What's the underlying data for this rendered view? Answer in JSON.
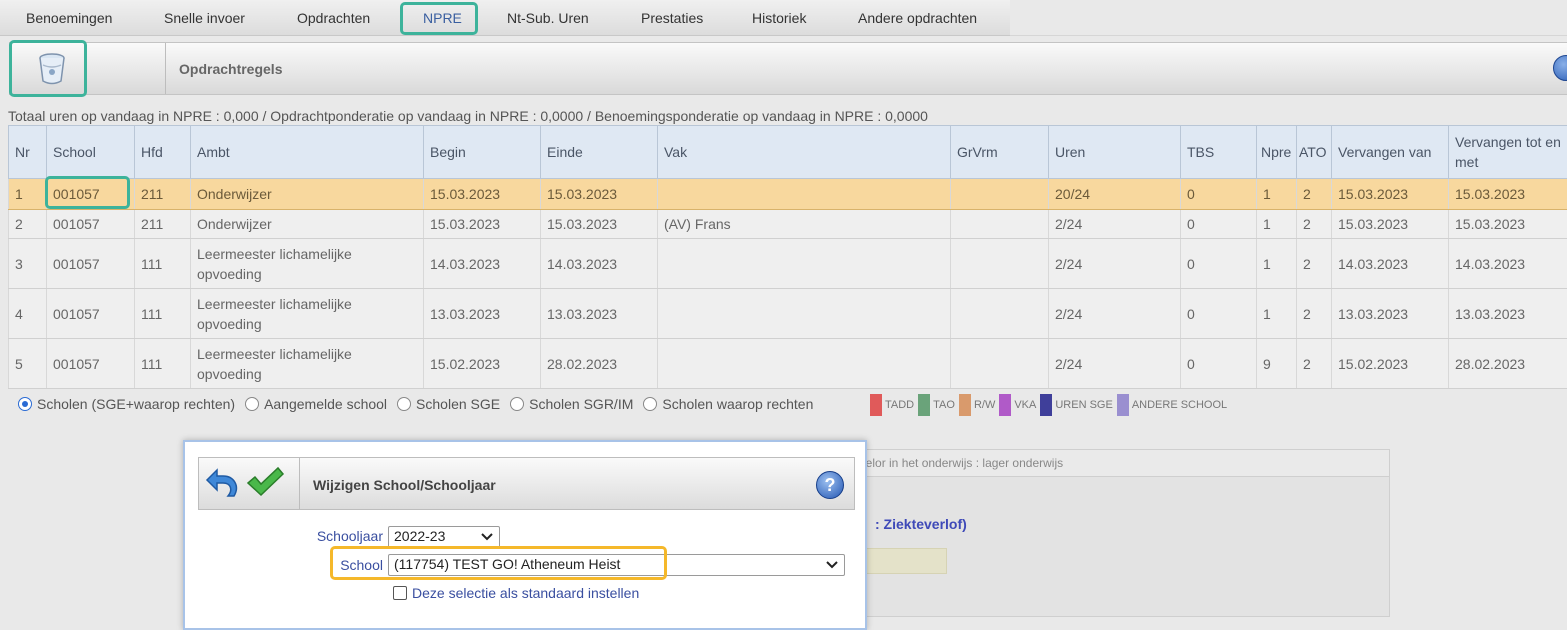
{
  "tabs": [
    {
      "label": "Benoemingen",
      "active": false
    },
    {
      "label": "Snelle invoer",
      "active": false
    },
    {
      "label": "Opdrachten",
      "active": false
    },
    {
      "label": "NPRE",
      "active": true
    },
    {
      "label": "Nt-Sub. Uren",
      "active": false
    },
    {
      "label": "Prestaties",
      "active": false
    },
    {
      "label": "Historiek",
      "active": false
    },
    {
      "label": "Andere opdrachten",
      "active": false
    }
  ],
  "toolbar": {
    "title": "Opdrachtregels"
  },
  "totals": "Totaal uren op vandaag in NPRE : 0,000 / Opdrachtponderatie op vandaag in NPRE : 0,0000 / Benoemingsponderatie op vandaag in NPRE : 0,0000",
  "table": {
    "headers": [
      "Nr",
      "School",
      "Hfd",
      "Ambt",
      "Begin",
      "Einde",
      "Vak",
      "GrVrm",
      "Uren",
      "TBS",
      "Npre",
      "ATO",
      "Vervangen van",
      "Vervangen tot en met"
    ],
    "rows": [
      [
        "1",
        "001057",
        "211",
        "Onderwijzer",
        "15.03.2023",
        "15.03.2023",
        "",
        "",
        "20/24",
        "0",
        "1",
        "2",
        "15.03.2023",
        "15.03.2023"
      ],
      [
        "2",
        "001057",
        "211",
        "Onderwijzer",
        "15.03.2023",
        "15.03.2023",
        "(AV) Frans",
        "",
        "2/24",
        "0",
        "1",
        "2",
        "15.03.2023",
        "15.03.2023"
      ],
      [
        "3",
        "001057",
        "111",
        "Leermeester lichamelijke opvoeding",
        "14.03.2023",
        "14.03.2023",
        "",
        "",
        "2/24",
        "0",
        "1",
        "2",
        "14.03.2023",
        "14.03.2023"
      ],
      [
        "4",
        "001057",
        "111",
        "Leermeester lichamelijke opvoeding",
        "13.03.2023",
        "13.03.2023",
        "",
        "",
        "2/24",
        "0",
        "1",
        "2",
        "13.03.2023",
        "13.03.2023"
      ],
      [
        "5",
        "001057",
        "111",
        "Leermeester lichamelijke opvoeding",
        "15.02.2023",
        "28.02.2023",
        "",
        "",
        "2/24",
        "0",
        "9",
        "2",
        "15.02.2023",
        "28.02.2023"
      ]
    ]
  },
  "radios": [
    {
      "label": "Scholen (SGE+waarop rechten)",
      "checked": true
    },
    {
      "label": "Aangemelde school",
      "checked": false
    },
    {
      "label": "Scholen SGE",
      "checked": false
    },
    {
      "label": "Scholen SGR/IM",
      "checked": false
    },
    {
      "label": "Scholen waarop rechten",
      "checked": false
    }
  ],
  "legend": [
    {
      "label": "TADD",
      "color": "#e05a5a"
    },
    {
      "label": "TAO",
      "color": "#6aa37a"
    },
    {
      "label": "R/W",
      "color": "#d99a6c"
    },
    {
      "label": "VKA",
      "color": "#b05ac8"
    },
    {
      "label": "UREN SGE",
      "color": "#3f3f9a"
    },
    {
      "label": "ANDERE SCHOOL",
      "color": "#9a8fd0"
    }
  ],
  "background_panel": {
    "header": "helor in het onderwijs : lager onderwijs",
    "link": ": Ziekteverlof)"
  },
  "dialog": {
    "title": "Wijzigen School/Schooljaar",
    "help": "?",
    "schooljaar_label": "Schooljaar",
    "schooljaar_value": "2022-23",
    "school_label": "School",
    "school_value": "(117754) TEST GO! Atheneum Heist",
    "checkbox_label": "Deze selectie als standaard instellen"
  }
}
